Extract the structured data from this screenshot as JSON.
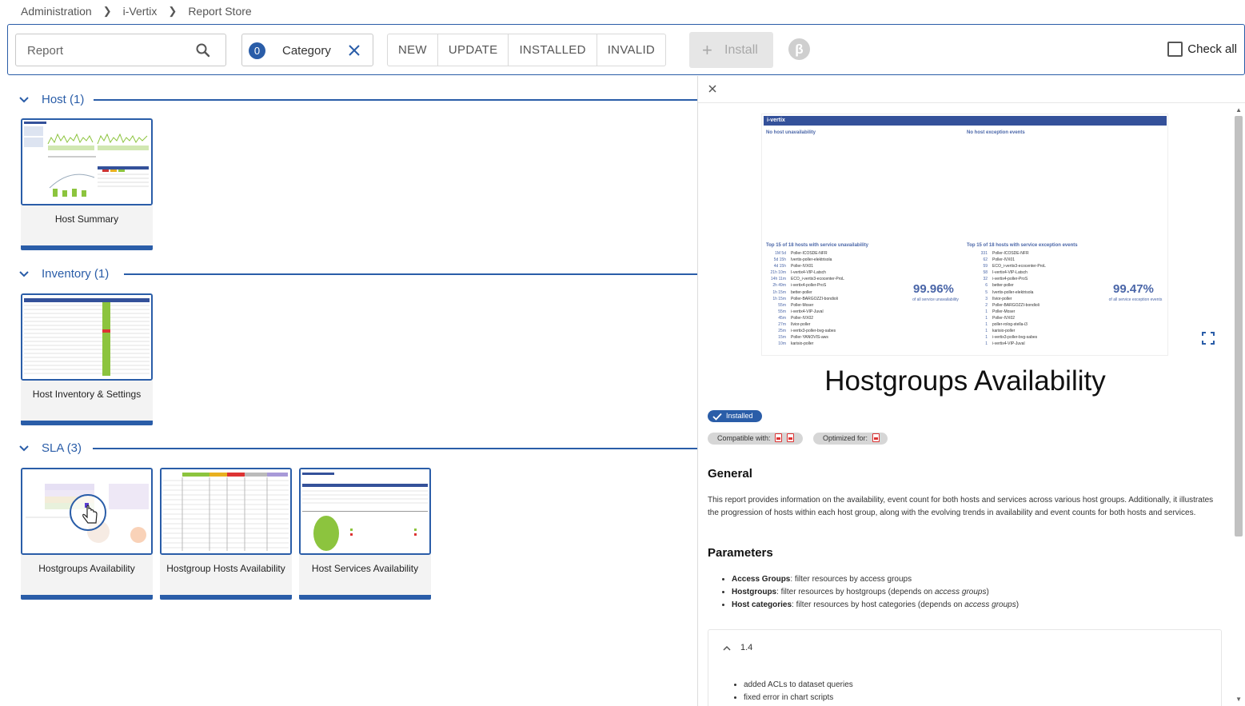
{
  "breadcrumb": [
    "Administration",
    "i-Vertix",
    "Report Store"
  ],
  "search": {
    "placeholder": "Report"
  },
  "category": {
    "count": "0",
    "label": "Category"
  },
  "filters": [
    "NEW",
    "UPDATE",
    "INSTALLED",
    "INVALID"
  ],
  "install_label": "Install",
  "beta_symbol": "β",
  "check_all_label": "Check all",
  "sections": [
    {
      "title": "Host (1)",
      "cards": [
        "Host Summary"
      ]
    },
    {
      "title": "Inventory (1)",
      "cards": [
        "Host Inventory & Settings"
      ]
    },
    {
      "title": "SLA (3)",
      "cards": [
        "Hostgroups Availability",
        "Hostgroup Hosts Availability",
        "Host Services Availability"
      ]
    }
  ],
  "detail": {
    "preview": {
      "header": "i-vertix",
      "left_note": "No host unavailability",
      "right_note": "No host exception events",
      "left_table_title": "Top 15 of 18 hosts with service unavailability",
      "right_table_title": "Top 15 of 18 hosts with service exception events",
      "left_pct": "99.96%",
      "left_caption": "of all service unavailability",
      "right_pct": "99.47%",
      "right_caption": "of all service exception events"
    },
    "title": "Hostgroups Availability",
    "installed_label": "Installed",
    "compatible_label": "Compatible with:",
    "optimized_label": "Optimized for:",
    "general_heading": "General",
    "general_text": "This report provides information on the availability, event count for both hosts and services across various host groups. Additionally, it illustrates the progression of hosts within each host group, along with the evolving trends in availability and event counts for both hosts and services.",
    "parameters_heading": "Parameters",
    "parameters": [
      {
        "name": "Access Groups",
        "text": ": filter resources by access groups",
        "note": ""
      },
      {
        "name": "Hostgroups",
        "text": ": filter resources by hostgroups (depends on ",
        "note": "access groups"
      },
      {
        "name": "Host categories",
        "text": ": filter resources by host categories (depends on ",
        "note": "access groups"
      }
    ],
    "changelog_version": "1.4",
    "changelog_items": [
      "added ACLs to dataset queries",
      "fixed error in chart scripts"
    ]
  },
  "colors": {
    "accent": "#2a5da8",
    "preview_header": "#34519a",
    "green": "#8cc43e"
  }
}
